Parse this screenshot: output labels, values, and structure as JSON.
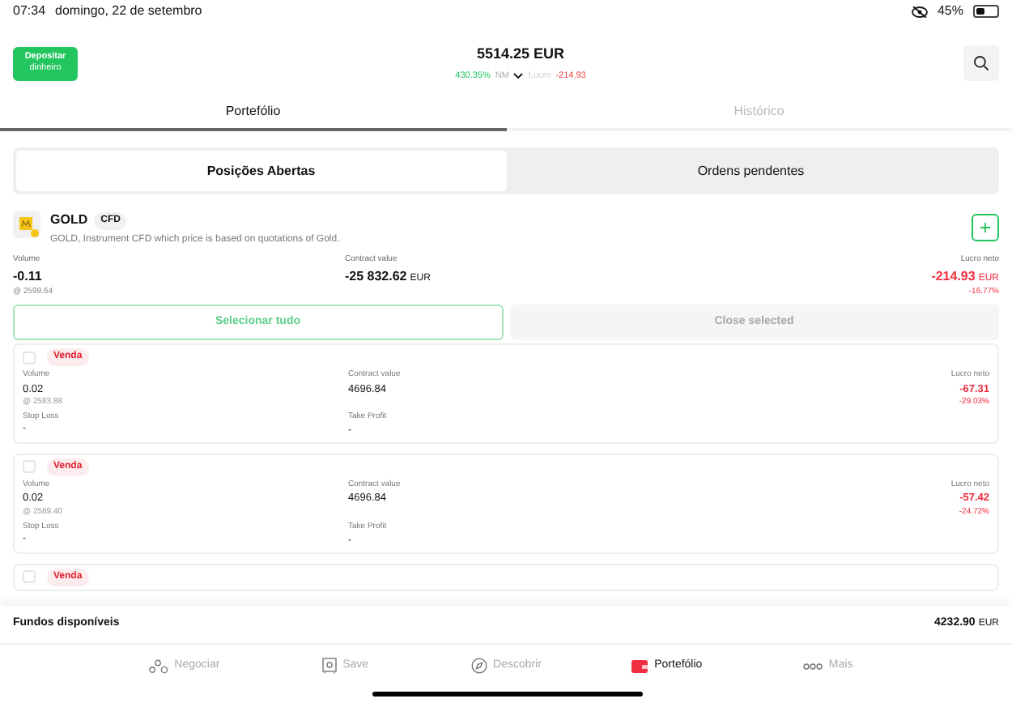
{
  "status_bar": {
    "time": "07:34",
    "date": "domingo, 22 de setembro",
    "battery": "45%"
  },
  "header": {
    "deposit_button": [
      "Depositar",
      "dinheiro"
    ],
    "balance": "5514.25 EUR",
    "nm_value": "430.35%",
    "nm_label": "NM",
    "profit_label": "Lucro",
    "profit_value": "-214.93"
  },
  "tabs": [
    {
      "label": "Portefólio",
      "selected": true
    },
    {
      "label": "Histórico",
      "selected": false
    }
  ],
  "segments": [
    {
      "label": "Posições Abertas",
      "selected": true
    },
    {
      "label": "Ordens pendentes",
      "selected": false
    }
  ],
  "instrument": {
    "name": "GOLD",
    "badge": "CFD",
    "description": "GOLD, Instrument CFD which price is based on quotations of Gold.",
    "volume_label": "Volume",
    "volume": "-0.11",
    "price": "@ 2599.64",
    "contract_label": "Contract value",
    "contract_value": "-25 832.62",
    "contract_currency": "EUR",
    "profit_label": "Lucro neto",
    "profit": "-214.93",
    "profit_currency": "EUR",
    "profit_pct": "-16.77%"
  },
  "actions": [
    {
      "label": "Selecionar tudo",
      "disabled": false
    },
    {
      "label": "Close selected",
      "disabled": true
    }
  ],
  "positions": [
    {
      "checked": false,
      "side": "Venda",
      "volume_label": "Volume",
      "volume": "0.02",
      "price": "@ 2583.88",
      "contract_label": "Contract value",
      "contract_value": "4696.84",
      "profit_label": "Lucro neto",
      "profit": "-67.31",
      "profit_pct": "-29.03%",
      "sl_label": "Stop Loss",
      "sl": "-",
      "tp_label": "Take Profit",
      "tp": "-"
    },
    {
      "checked": false,
      "side": "Venda",
      "volume_label": "Volume",
      "volume": "0.02",
      "price": "@ 2589.40",
      "contract_label": "Contract value",
      "contract_value": "4696.84",
      "profit_label": "Lucro neto",
      "profit": "-57.42",
      "profit_pct": "-24.72%",
      "sl_label": "Stop Loss",
      "sl": "-",
      "tp_label": "Take Profit",
      "tp": "-"
    },
    {
      "checked": false,
      "side": "Venda"
    }
  ],
  "funds": {
    "label": "Fundos disponíveis",
    "value": "4232.90",
    "currency": "EUR"
  },
  "nav": [
    {
      "label": "Negociar",
      "kind": "trade",
      "selected": false
    },
    {
      "label": "Save",
      "kind": "save",
      "selected": false
    },
    {
      "label": "Descobrir",
      "kind": "discover",
      "selected": false
    },
    {
      "label": "Portefólio",
      "kind": "portfolio",
      "selected": true
    },
    {
      "label": "Mais",
      "kind": "more",
      "selected": false
    }
  ]
}
